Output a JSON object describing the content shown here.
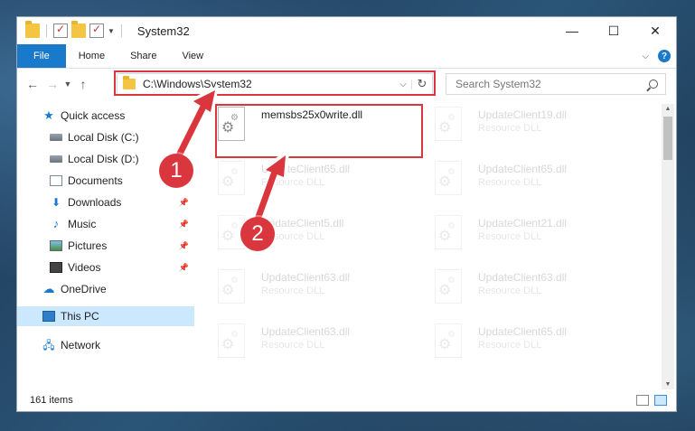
{
  "window": {
    "title": "System32"
  },
  "ribbon": {
    "tabs": [
      "File",
      "Home",
      "Share",
      "View"
    ]
  },
  "address": {
    "path": "C:\\Windows\\System32"
  },
  "search": {
    "placeholder": "Search System32"
  },
  "nav": {
    "items": [
      {
        "label": "Quick access"
      },
      {
        "label": "Local Disk (C:)"
      },
      {
        "label": "Local Disk (D:)"
      },
      {
        "label": "Documents"
      },
      {
        "label": "Downloads"
      },
      {
        "label": "Music"
      },
      {
        "label": "Pictures"
      },
      {
        "label": "Videos"
      },
      {
        "label": "OneDrive"
      },
      {
        "label": "This PC"
      },
      {
        "label": "Network"
      }
    ]
  },
  "files": [
    {
      "name": "memsbs25x0write.dll",
      "type": ""
    },
    {
      "name": "UpdateClient19.dll",
      "type": "Resource DLL"
    },
    {
      "name": "UpdateClient65.dll",
      "type": "Resource DLL"
    },
    {
      "name": "UpdateClient65.dll",
      "type": "Resource DLL"
    },
    {
      "name": "UpdateClient5.dll",
      "type": "Resource DLL"
    },
    {
      "name": "UpdateClient21.dll",
      "type": "Resource DLL"
    },
    {
      "name": "UpdateClient63.dll",
      "type": "Resource DLL"
    },
    {
      "name": "UpdateClient63.dll",
      "type": "Resource DLL"
    },
    {
      "name": "UpdateClient63.dll",
      "type": "Resource DLL"
    },
    {
      "name": "UpdateClient65.dll",
      "type": "Resource DLL"
    }
  ],
  "status": {
    "count": "161 items"
  },
  "annotations": {
    "badge1": "1",
    "badge2": "2",
    "color": "#d9363e"
  }
}
